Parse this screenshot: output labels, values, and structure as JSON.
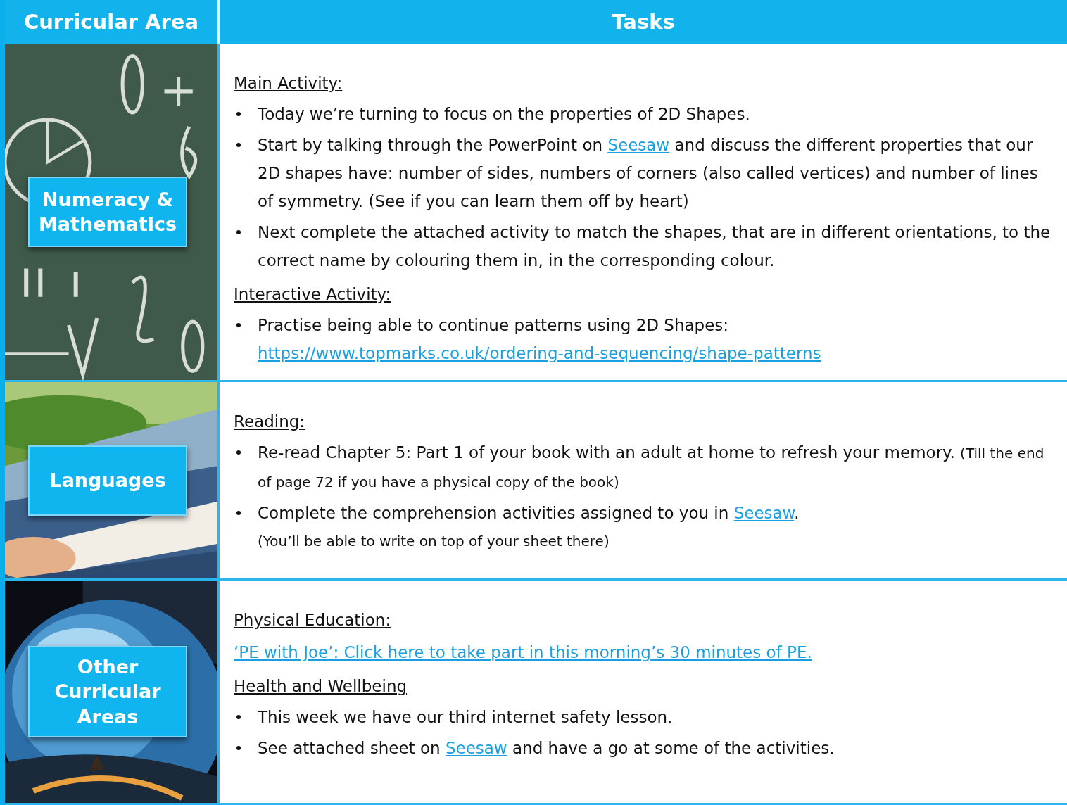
{
  "header": {
    "columns": [
      "Curricular Area",
      "Tasks"
    ]
  },
  "rows": [
    {
      "area": "Numeracy & Mathematics",
      "picture": {
        "kind": "picture"
      },
      "blocks": [
        {
          "kind": "heading",
          "text": "Main Activity:"
        },
        {
          "kind": "bullet",
          "parts": [
            {
              "kind": "text",
              "text": "Today we’re turning to focus on the properties of 2D Shapes."
            }
          ]
        },
        {
          "kind": "bullet",
          "parts": [
            {
              "kind": "text",
              "text": "Start by talking through the PowerPoint on "
            },
            {
              "kind": "link",
              "text": "Seesaw"
            },
            {
              "kind": "text",
              "text": " and discuss the different properties that our 2D shapes have: number of sides, numbers of corners (also called vertices) and number of lines of symmetry. (See if you can learn them off by heart)"
            }
          ]
        },
        {
          "kind": "bullet",
          "parts": [
            {
              "kind": "text",
              "text": "Next complete the attached activity to match the shapes, that are in different orientations, to the correct name by colouring them in, in the corresponding colour."
            }
          ]
        },
        {
          "kind": "heading",
          "text": "Interactive Activity:"
        },
        {
          "kind": "bullet",
          "parts": [
            {
              "kind": "text",
              "text": "Practise being able to continue patterns using 2D Shapes:"
            },
            {
              "kind": "link_line",
              "text": "https://www.topmarks.co.uk/ordering-and-sequencing/shape-patterns"
            }
          ]
        }
      ]
    },
    {
      "area": "Languages",
      "picture": {
        "kind": "picture"
      },
      "blocks": [
        {
          "kind": "heading",
          "text": "Reading:"
        },
        {
          "kind": "bullet",
          "parts": [
            {
              "kind": "text",
              "text": "Re-read Chapter 5: Part 1 of your book with an adult at home to refresh your memory. "
            },
            {
              "kind": "note",
              "text": "(Till the end of page 72 if you have a physical copy of the book)"
            }
          ]
        },
        {
          "kind": "bullet",
          "parts": [
            {
              "kind": "text",
              "text": "Complete the comprehension activities assigned to you in "
            },
            {
              "kind": "link",
              "text": "Seesaw"
            },
            {
              "kind": "text",
              "text": "."
            },
            {
              "kind": "note_line",
              "text": "(You’ll be able to write on top of your sheet there)"
            }
          ]
        }
      ]
    },
    {
      "area": "Other Curricular Areas",
      "picture": {
        "kind": "picture"
      },
      "blocks": [
        {
          "kind": "heading",
          "text": "Physical Education:"
        },
        {
          "kind": "paragraph",
          "parts": [
            {
              "kind": "link",
              "text": "‘PE with Joe’: Click here to take part in this morning’s 30 minutes of PE."
            }
          ]
        },
        {
          "kind": "heading",
          "text": "Health and Wellbeing"
        },
        {
          "kind": "bullet",
          "parts": [
            {
              "kind": "text",
              "text": "This week we have our third internet safety lesson."
            }
          ]
        },
        {
          "kind": "bullet",
          "parts": [
            {
              "kind": "text",
              "text": "See attached sheet on "
            },
            {
              "kind": "link",
              "text": "Seesaw"
            },
            {
              "kind": "text",
              "text": " and have a go at some of the activities."
            }
          ]
        }
      ]
    }
  ]
}
